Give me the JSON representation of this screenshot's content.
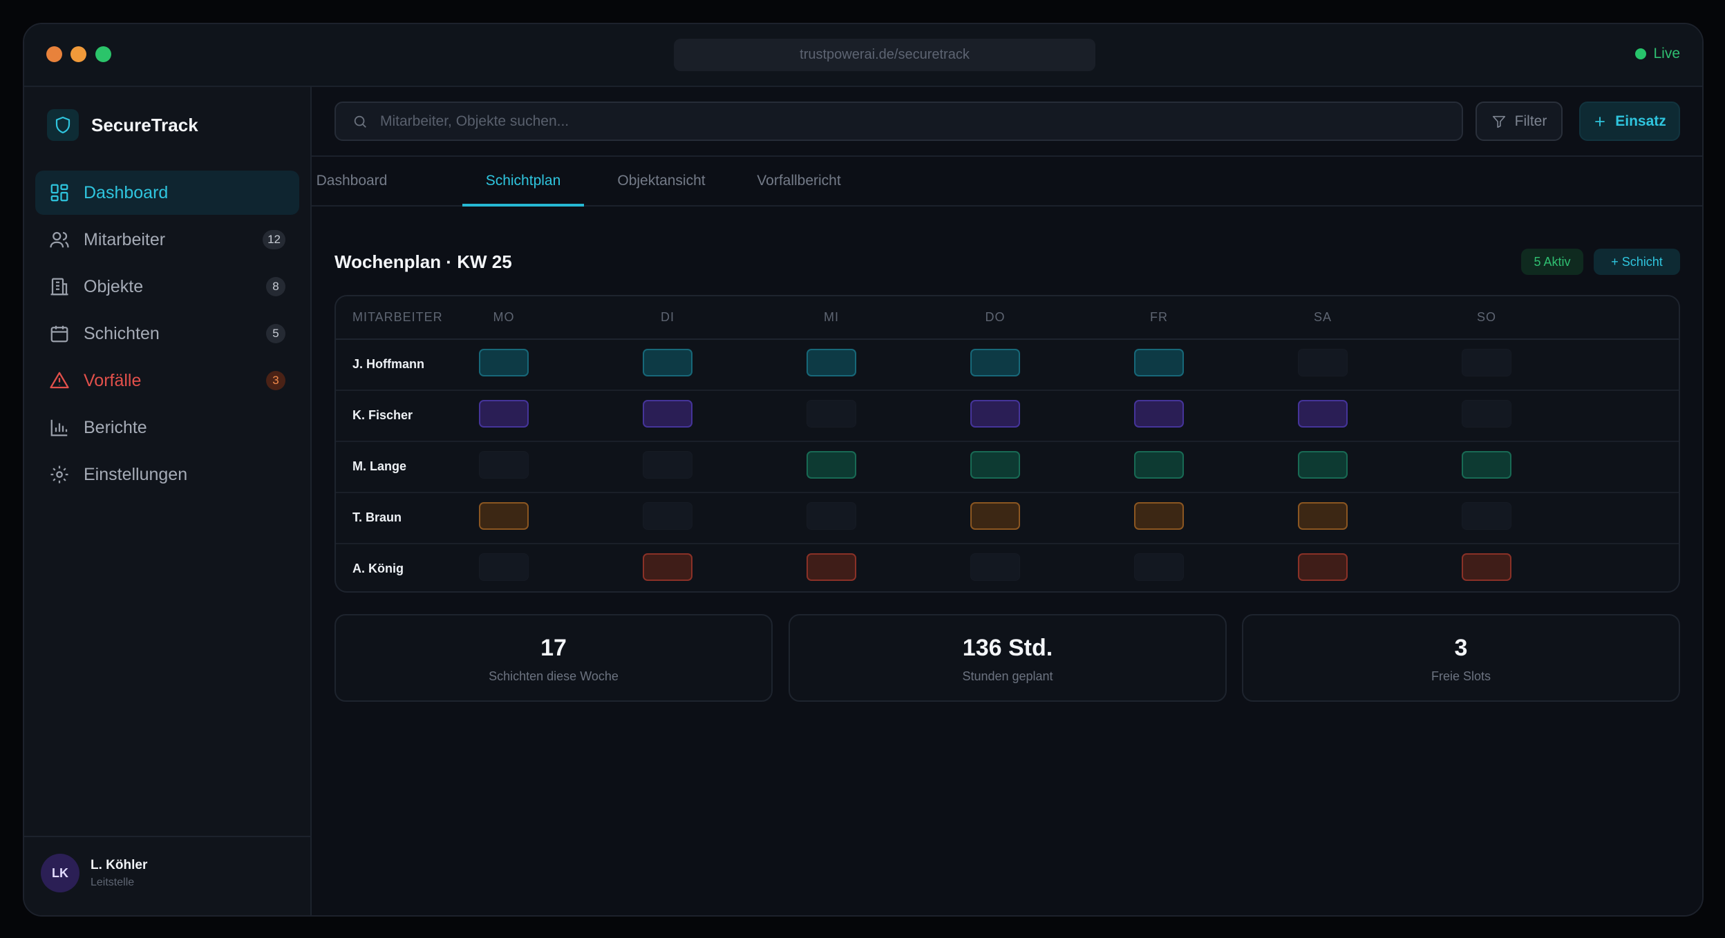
{
  "titlebar": {
    "url": "trustpowerai.de/securetrack",
    "live_label": "Live",
    "traffic_lights": [
      "#e8823b",
      "#f09a3a",
      "#2bc46a"
    ]
  },
  "sidebar": {
    "brand": "SecureTrack",
    "items": [
      {
        "label": "Dashboard",
        "icon": "grid-icon",
        "badge": null,
        "state": "active"
      },
      {
        "label": "Mitarbeiter",
        "icon": "users-icon",
        "badge": "12",
        "state": "normal"
      },
      {
        "label": "Objekte",
        "icon": "building-icon",
        "badge": "8",
        "state": "normal"
      },
      {
        "label": "Schichten",
        "icon": "calendar-icon",
        "badge": "5",
        "state": "normal"
      },
      {
        "label": "Vorfälle",
        "icon": "warning-icon",
        "badge": "3",
        "state": "alert"
      },
      {
        "label": "Berichte",
        "icon": "bar-chart-icon",
        "badge": null,
        "state": "normal"
      },
      {
        "label": "Einstellungen",
        "icon": "gear-icon",
        "badge": null,
        "state": "normal"
      }
    ],
    "user": {
      "initials": "LK",
      "name": "L. Köhler",
      "role": "Leitstelle"
    }
  },
  "search": {
    "placeholder": "Mitarbeiter, Objekte suchen..."
  },
  "toolbar": {
    "filter_label": "Filter",
    "add_label": "Einsatz"
  },
  "tabs": [
    {
      "label": "Dashboard",
      "active": false
    },
    {
      "label": "Schichtplan",
      "active": true
    },
    {
      "label": "Objektansicht",
      "active": false
    },
    {
      "label": "Vorfallbericht",
      "active": false
    }
  ],
  "schedule": {
    "title": "Wochenplan · KW 25",
    "active_badge": "5 Aktiv",
    "add_shift_label": "Schicht",
    "header": [
      "MITARBEITER",
      "MO",
      "DI",
      "MI",
      "DO",
      "FR",
      "SA",
      "SO"
    ],
    "rows": [
      {
        "name": "J. Hoffmann",
        "color": "cyan",
        "days": [
          1,
          1,
          1,
          1,
          1,
          0,
          0
        ]
      },
      {
        "name": "K. Fischer",
        "color": "purple",
        "days": [
          1,
          1,
          0,
          1,
          1,
          1,
          0
        ]
      },
      {
        "name": "M. Lange",
        "color": "green",
        "days": [
          0,
          0,
          1,
          1,
          1,
          1,
          1
        ]
      },
      {
        "name": "T. Braun",
        "color": "orange",
        "days": [
          1,
          0,
          0,
          1,
          1,
          1,
          0
        ]
      },
      {
        "name": "A. König",
        "color": "red",
        "days": [
          0,
          1,
          1,
          0,
          0,
          1,
          1
        ]
      }
    ]
  },
  "stats": [
    {
      "value": "17",
      "label": "Schichten diese Woche"
    },
    {
      "value": "136 Std.",
      "label": "Stunden geplant"
    },
    {
      "value": "3",
      "label": "Freie Slots"
    }
  ],
  "colors": {
    "accent": "#2fc5de",
    "alert": "#e2504b",
    "live": "#2fbf71"
  }
}
